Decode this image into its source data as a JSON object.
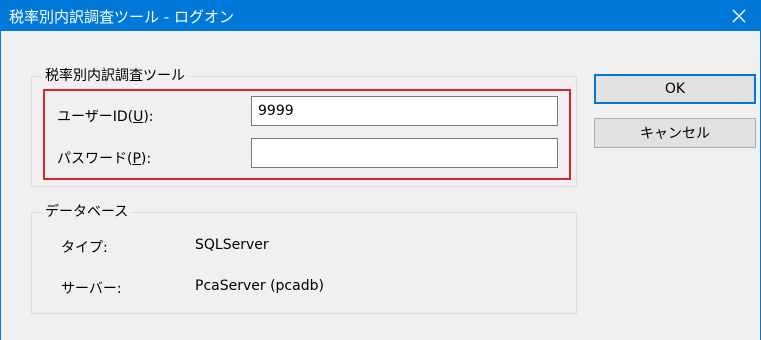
{
  "window": {
    "title": "税率別内訳調査ツール - ログオン",
    "accent_color": "#0078d7",
    "close_icon": "close-icon"
  },
  "login_group": {
    "label": "税率別内訳調査ツール",
    "user_id": {
      "label_prefix": "ユーザーID(",
      "label_key": "U",
      "label_suffix": "):",
      "value": "9999"
    },
    "password": {
      "label_prefix": "パスワード(",
      "label_key": "P",
      "label_suffix": "):",
      "value": ""
    },
    "highlight_color": "#e0202a"
  },
  "database_group": {
    "label": "データベース",
    "type_label": "タイプ:",
    "type_value": "SQLServer",
    "server_label": "サーバー:",
    "server_value": "PcaServer (pcadb)"
  },
  "buttons": {
    "ok_label": "OK",
    "cancel_label": "キャンセル"
  }
}
